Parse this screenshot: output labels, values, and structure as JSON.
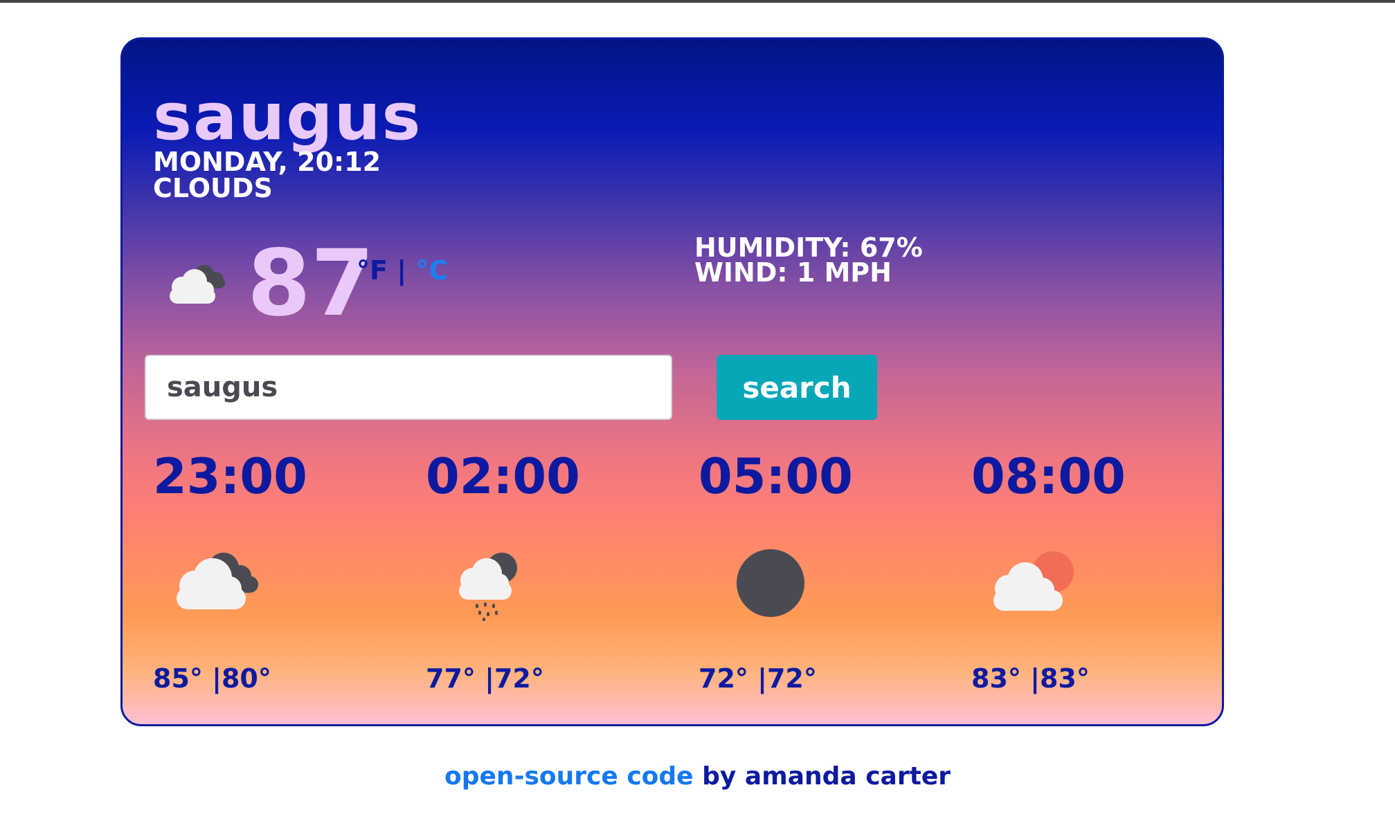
{
  "weather": {
    "city": "saugus",
    "date_time": "MONDAY, 20:12",
    "description": "CLOUDS",
    "temperature": "87",
    "unit_f": "°F",
    "unit_sep": " | ",
    "unit_c": "°C",
    "humidity": "HUMIDITY: 67%",
    "wind": "WIND: 1 MPH",
    "icon": "cloudy-icon"
  },
  "search": {
    "value": "saugus",
    "button_label": "search"
  },
  "forecast": [
    {
      "time": "23:00",
      "temps": "85° |80°",
      "icon": "broken-clouds-night-icon"
    },
    {
      "time": "02:00",
      "temps": "77° |72°",
      "icon": "rain-night-icon"
    },
    {
      "time": "05:00",
      "temps": "72° |72°",
      "icon": "clear-night-moon-icon"
    },
    {
      "time": "08:00",
      "temps": "83° |83°",
      "icon": "partly-cloudy-day-icon"
    }
  ],
  "footer": {
    "link_text": "open-source code",
    "by_text": " by amanda carter"
  },
  "colors": {
    "accent_text": "#0d1aa0",
    "city_color": "#e9c9fa",
    "button": "#08a7b8",
    "link": "#1578f0"
  }
}
